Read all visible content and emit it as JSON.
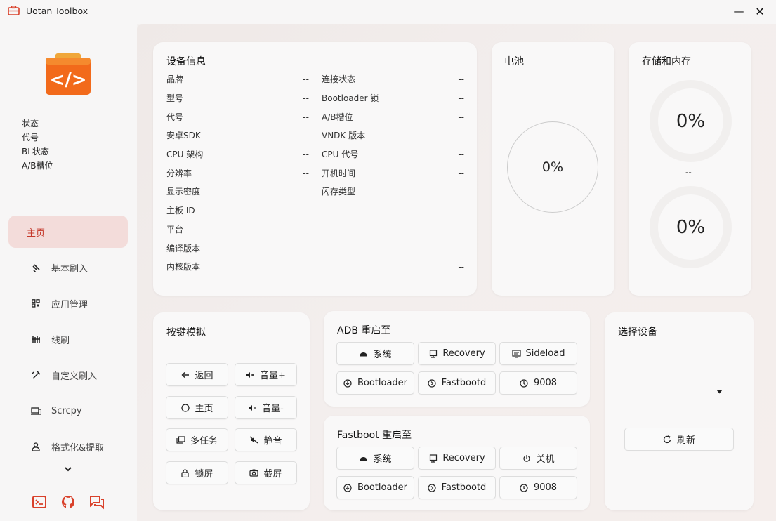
{
  "app": {
    "title": "Uotan Toolbox",
    "minimize_glyph": "—",
    "close_glyph": "✕"
  },
  "sidebar": {
    "status": [
      {
        "label": "状态",
        "value": "--"
      },
      {
        "label": "代号",
        "value": "--"
      },
      {
        "label": "BL状态",
        "value": "--"
      },
      {
        "label": "A/B槽位",
        "value": "--"
      }
    ],
    "nav": [
      {
        "label": "主页",
        "icon": "home-icon",
        "active": true
      },
      {
        "label": "基本刷入",
        "icon": "flash-icon"
      },
      {
        "label": "应用管理",
        "icon": "apps-icon"
      },
      {
        "label": "线刷",
        "icon": "cable-flash-icon"
      },
      {
        "label": "自定义刷入",
        "icon": "custom-flash-icon"
      },
      {
        "label": "Scrcpy",
        "icon": "screen-mirror-icon"
      },
      {
        "label": "格式化&提取",
        "icon": "format-extract-icon"
      }
    ],
    "bottom_icons": [
      "terminal-icon",
      "github-icon",
      "feedback-icon"
    ]
  },
  "device_info": {
    "title": "设备信息",
    "left": [
      {
        "label": "品牌",
        "value": "--"
      },
      {
        "label": "型号",
        "value": "--"
      },
      {
        "label": "代号",
        "value": "--"
      },
      {
        "label": "安卓SDK",
        "value": "--"
      },
      {
        "label": "CPU 架构",
        "value": "--"
      },
      {
        "label": "分辨率",
        "value": "--"
      },
      {
        "label": "显示密度",
        "value": "--"
      },
      {
        "label": "主板 ID",
        "value": ""
      },
      {
        "label": "平台",
        "value": ""
      },
      {
        "label": "编译版本",
        "value": ""
      },
      {
        "label": "内核版本",
        "value": ""
      }
    ],
    "right": [
      {
        "label": "连接状态",
        "value": "--"
      },
      {
        "label": "Bootloader 锁",
        "value": "--"
      },
      {
        "label": "A/B槽位",
        "value": "--"
      },
      {
        "label": "VNDK 版本",
        "value": "--"
      },
      {
        "label": "CPU 代号",
        "value": "--"
      },
      {
        "label": "开机时间",
        "value": "--"
      },
      {
        "label": "闪存类型",
        "value": "--"
      },
      {
        "label": "",
        "value": "--"
      },
      {
        "label": "",
        "value": "--"
      },
      {
        "label": "",
        "value": "--"
      },
      {
        "label": "",
        "value": "--"
      }
    ]
  },
  "battery": {
    "title": "电池",
    "percent": "0%",
    "detail": "--"
  },
  "storage": {
    "title": "存储和内存",
    "storage_percent": "0%",
    "storage_detail": "--",
    "memory_percent": "0%",
    "memory_detail": "--"
  },
  "key_sim": {
    "title": "按键模拟",
    "buttons": [
      {
        "label": "返回",
        "icon": "back-arrow-icon"
      },
      {
        "label": "音量+",
        "icon": "volume-up-icon"
      },
      {
        "label": "主页",
        "icon": "home-circle-icon"
      },
      {
        "label": "音量-",
        "icon": "volume-down-icon"
      },
      {
        "label": "多任务",
        "icon": "multitask-icon"
      },
      {
        "label": "静音",
        "icon": "mute-icon"
      },
      {
        "label": "锁屏",
        "icon": "lock-icon"
      },
      {
        "label": "截屏",
        "icon": "camera-icon"
      }
    ]
  },
  "adb_reboot": {
    "title": "ADB 重启至",
    "buttons": [
      {
        "label": "系统",
        "icon": "android-icon"
      },
      {
        "label": "Recovery",
        "icon": "recovery-icon"
      },
      {
        "label": "Sideload",
        "icon": "sideload-icon"
      },
      {
        "label": "Bootloader",
        "icon": "bootloader-icon"
      },
      {
        "label": "Fastbootd",
        "icon": "fastbootd-icon"
      },
      {
        "label": "9008",
        "icon": "edl-icon"
      }
    ]
  },
  "fastboot_reboot": {
    "title": "Fastboot 重启至",
    "buttons": [
      {
        "label": "系统",
        "icon": "android-icon"
      },
      {
        "label": "Recovery",
        "icon": "recovery-icon"
      },
      {
        "label": "关机",
        "icon": "power-icon"
      },
      {
        "label": "Bootloader",
        "icon": "bootloader-icon"
      },
      {
        "label": "Fastbootd",
        "icon": "fastbootd-icon"
      },
      {
        "label": "9008",
        "icon": "edl-icon"
      }
    ]
  },
  "select_device": {
    "title": "选择设备",
    "selected": "",
    "refresh_label": "刷新"
  },
  "colors": {
    "accent": "#c53a2c",
    "active_nav_bg": "#f3dcda",
    "logo_orange": "#f26a1b"
  }
}
